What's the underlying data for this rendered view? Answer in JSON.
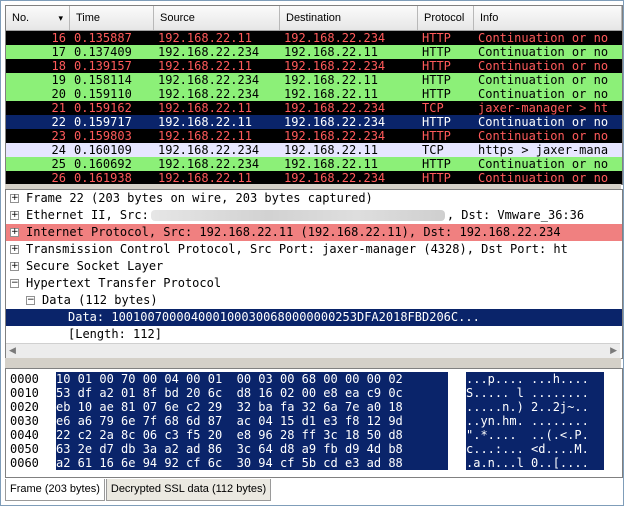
{
  "packet_list": {
    "columns": [
      "No.",
      "Time",
      "Source",
      "Destination",
      "Protocol",
      "Info"
    ],
    "sort_icon": "▾",
    "rows": [
      {
        "no": "16",
        "time": "0.135887",
        "src": "192.168.22.11",
        "dst": "192.168.22.234",
        "proto": "HTTP",
        "info": "Continuation or no",
        "bg": "#000000",
        "fg": "#ff5a5a"
      },
      {
        "no": "17",
        "time": "0.137409",
        "src": "192.168.22.234",
        "dst": "192.168.22.11",
        "proto": "HTTP",
        "info": "Continuation or no",
        "bg": "#8cf078",
        "fg": "#000000"
      },
      {
        "no": "18",
        "time": "0.139157",
        "src": "192.168.22.11",
        "dst": "192.168.22.234",
        "proto": "HTTP",
        "info": "Continuation or no",
        "bg": "#000000",
        "fg": "#ff5a5a"
      },
      {
        "no": "19",
        "time": "0.158114",
        "src": "192.168.22.234",
        "dst": "192.168.22.11",
        "proto": "HTTP",
        "info": "Continuation or no",
        "bg": "#8cf078",
        "fg": "#000000"
      },
      {
        "no": "20",
        "time": "0.159110",
        "src": "192.168.22.234",
        "dst": "192.168.22.11",
        "proto": "HTTP",
        "info": "Continuation or no",
        "bg": "#8cf078",
        "fg": "#000000"
      },
      {
        "no": "21",
        "time": "0.159162",
        "src": "192.168.22.11",
        "dst": "192.168.22.234",
        "proto": "TCP",
        "info": "jaxer-manager > ht",
        "bg": "#000000",
        "fg": "#ff5a5a"
      },
      {
        "no": "22",
        "time": "0.159717",
        "src": "192.168.22.11",
        "dst": "192.168.22.234",
        "proto": "HTTP",
        "info": "Continuation or no",
        "bg": "#0a246a",
        "fg": "#ffffff"
      },
      {
        "no": "23",
        "time": "0.159803",
        "src": "192.168.22.11",
        "dst": "192.168.22.234",
        "proto": "HTTP",
        "info": "Continuation or no",
        "bg": "#000000",
        "fg": "#ff5a5a"
      },
      {
        "no": "24",
        "time": "0.160109",
        "src": "192.168.22.234",
        "dst": "192.168.22.11",
        "proto": "TCP",
        "info": "https > jaxer-mana",
        "bg": "#e7e6ff",
        "fg": "#000000"
      },
      {
        "no": "25",
        "time": "0.160692",
        "src": "192.168.22.234",
        "dst": "192.168.22.11",
        "proto": "HTTP",
        "info": "Continuation or no",
        "bg": "#8cf078",
        "fg": "#000000"
      },
      {
        "no": "26",
        "time": "0.161938",
        "src": "192.168.22.11",
        "dst": "192.168.22.234",
        "proto": "HTTP",
        "info": "Continuation or no",
        "bg": "#000000",
        "fg": "#ff5a5a"
      }
    ]
  },
  "details": [
    {
      "toggle": "+",
      "indent": 0,
      "text": "Frame 22 (203 bytes on wire, 203 bytes captured)",
      "bg": "#ffffff",
      "fg": "#000000"
    },
    {
      "toggle": "+",
      "indent": 0,
      "text": "Ethernet II, Src:",
      "text2": ", Dst: Vmware_36:36",
      "blur": true,
      "bg": "#ffffff",
      "fg": "#000000"
    },
    {
      "toggle": "+",
      "indent": 0,
      "text": "Internet Protocol, Src: 192.168.22.11 (192.168.22.11), Dst: 192.168.22.234",
      "bg": "#f08080",
      "fg": "#000000"
    },
    {
      "toggle": "+",
      "indent": 0,
      "text": "Transmission Control Protocol, Src Port: jaxer-manager (4328), Dst Port: ht",
      "bg": "#ffffff",
      "fg": "#000000"
    },
    {
      "toggle": "+",
      "indent": 0,
      "text": "Secure Socket Layer",
      "bg": "#ffffff",
      "fg": "#000000"
    },
    {
      "toggle": "−",
      "indent": 0,
      "text": "Hypertext Transfer Protocol",
      "bg": "#ffffff",
      "fg": "#000000"
    },
    {
      "toggle": "−",
      "indent": 1,
      "text": "Data (112 bytes)",
      "bg": "#ffffff",
      "fg": "#000000"
    },
    {
      "toggle": "",
      "indent": 2,
      "text": "Data: 1001007000040001000300680000000253DFA2018FBD206C...",
      "bg": "#0a246a",
      "fg": "#ffffff"
    },
    {
      "toggle": "",
      "indent": 2,
      "text": "[Length: 112]",
      "bg": "#ffffff",
      "fg": "#000000"
    }
  ],
  "hex": [
    {
      "off": "0000",
      "bytes": "10 01 00 70 00 04 00 01  00 03 00 68 00 00 00 02",
      "ascii": "...p.... ...h...."
    },
    {
      "off": "0010",
      "bytes": "53 df a2 01 8f bd 20 6c  d8 16 02 00 e8 ea c9 0c",
      "ascii": "S..... l ........"
    },
    {
      "off": "0020",
      "bytes": "eb 10 ae 81 07 6e c2 29  32 ba fa 32 6a 7e a0 18",
      "ascii": ".....n.) 2..2j~.."
    },
    {
      "off": "0030",
      "bytes": "e6 a6 79 6e 7f 68 6d 87  ac 04 15 d1 e3 f8 12 9d",
      "ascii": "..yn.hm. ........"
    },
    {
      "off": "0040",
      "bytes": "22 c2 2a 8c 06 c3 f5 20  e8 96 28 ff 3c 18 50 d8",
      "ascii": "\".*....  ..(.<.P."
    },
    {
      "off": "0050",
      "bytes": "63 2e d7 db 3a a2 ad 86  3c 64 d8 a9 fb d9 4d b8",
      "ascii": "c...:... <d....M."
    },
    {
      "off": "0060",
      "bytes": "a2 61 16 6e 94 92 cf 6c  30 94 cf 5b cd e3 ad 88",
      "ascii": ".a.n...l 0..[...."
    }
  ],
  "tabs": [
    {
      "label": "Frame (203 bytes)",
      "active": true
    },
    {
      "label": "Decrypted SSL data (112 bytes)",
      "active": false
    }
  ]
}
